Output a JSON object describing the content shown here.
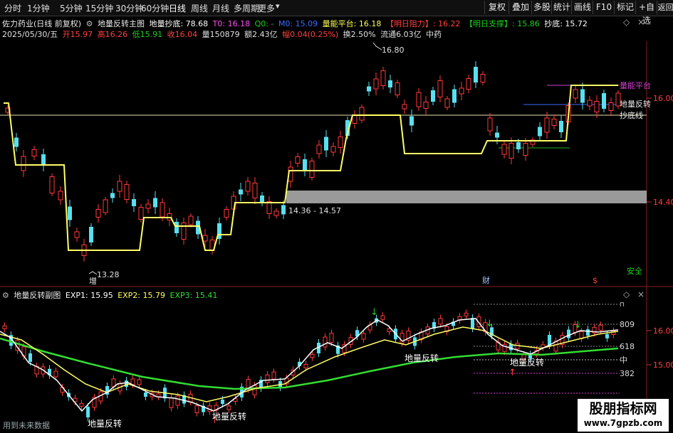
{
  "toolbar": {
    "periods": [
      "分时",
      "1分钟",
      "5分钟",
      "15分钟",
      "30分钟",
      "60分钟",
      "日线",
      "周线",
      "月线",
      "多周期",
      "更多"
    ],
    "right_buttons": [
      "复权",
      "叠加",
      "多股",
      "统计",
      "画线",
      "F10",
      "标记",
      "+自选",
      "返回"
    ]
  },
  "header": {
    "title": "佐力药业(日线 前复权)",
    "indicator_name": "地量反转主图",
    "params": [
      {
        "label": "地量抄底: 78.68",
        "color": "#ffffff"
      },
      {
        "label": "T0: 16.18",
        "color": "#ff4df0"
      },
      {
        "label": "Q0: -",
        "color": "#19d219"
      },
      {
        "label": "M0: 15.09",
        "color": "#3b6bff"
      },
      {
        "label": "量能平台: 16.18",
        "color": "#ffff55"
      },
      {
        "label": "【明日阻力】: 16.22",
        "color": "#ff4040"
      },
      {
        "label": "【明日支撑】: 15.86",
        "color": "#19d219"
      },
      {
        "label": "抄底: 15.72",
        "color": "#ffffff"
      }
    ],
    "date": "2025/05/30/五",
    "quote": [
      {
        "label": "开15.97",
        "color": "#ff4040"
      },
      {
        "label": "高16.26",
        "color": "#ff4040"
      },
      {
        "label": "低15.91",
        "color": "#19d219"
      },
      {
        "label": "收16.04",
        "color": "#ff4040"
      },
      {
        "label": "量150879",
        "color": "#e0e0e0"
      },
      {
        "label": "额2.43亿",
        "color": "#e0e0e0"
      },
      {
        "label": "幅0.04(0.25%)",
        "color": "#ff4040"
      },
      {
        "label": "换2.50%",
        "color": "#e0e0e0"
      },
      {
        "label": "流通6.03亿",
        "color": "#e0e0e0"
      },
      {
        "label": "中药",
        "color": "#e0e0e0"
      }
    ]
  },
  "main_chart": {
    "price_high": "16.80",
    "price_low": "13.28",
    "range_label": "14.36 - 14.57",
    "right_labels": [
      "量能平台",
      "地量反转",
      "抄底线"
    ],
    "axis_ticks": [
      "16.00",
      "14.40"
    ],
    "markers": {
      "zeng": "增",
      "cai": "财",
      "dollar": "$",
      "safe": "安全"
    },
    "colors": {
      "up": "#ff3a3a",
      "down": "#58e0f0",
      "platform": "#ffff66",
      "level": "#e8e0b0"
    }
  },
  "sub_chart": {
    "name": "地量反转副图",
    "params": [
      {
        "label": "EXP1: 15.95",
        "color": "#ffffff"
      },
      {
        "label": "EXP2: 15.79",
        "color": "#ffff66"
      },
      {
        "label": "EXP3: 15.41",
        "color": "#33dd33"
      }
    ],
    "signal_label": "地量反转",
    "level_labels": [
      "809",
      "618",
      "中",
      "382"
    ],
    "axis_ticks": [
      "16.00",
      "15.00"
    ]
  },
  "footer": {
    "note": "用到未来数据"
  },
  "watermark": {
    "line1": "股朋指标网",
    "line2": "www.7gpzb.com"
  }
}
